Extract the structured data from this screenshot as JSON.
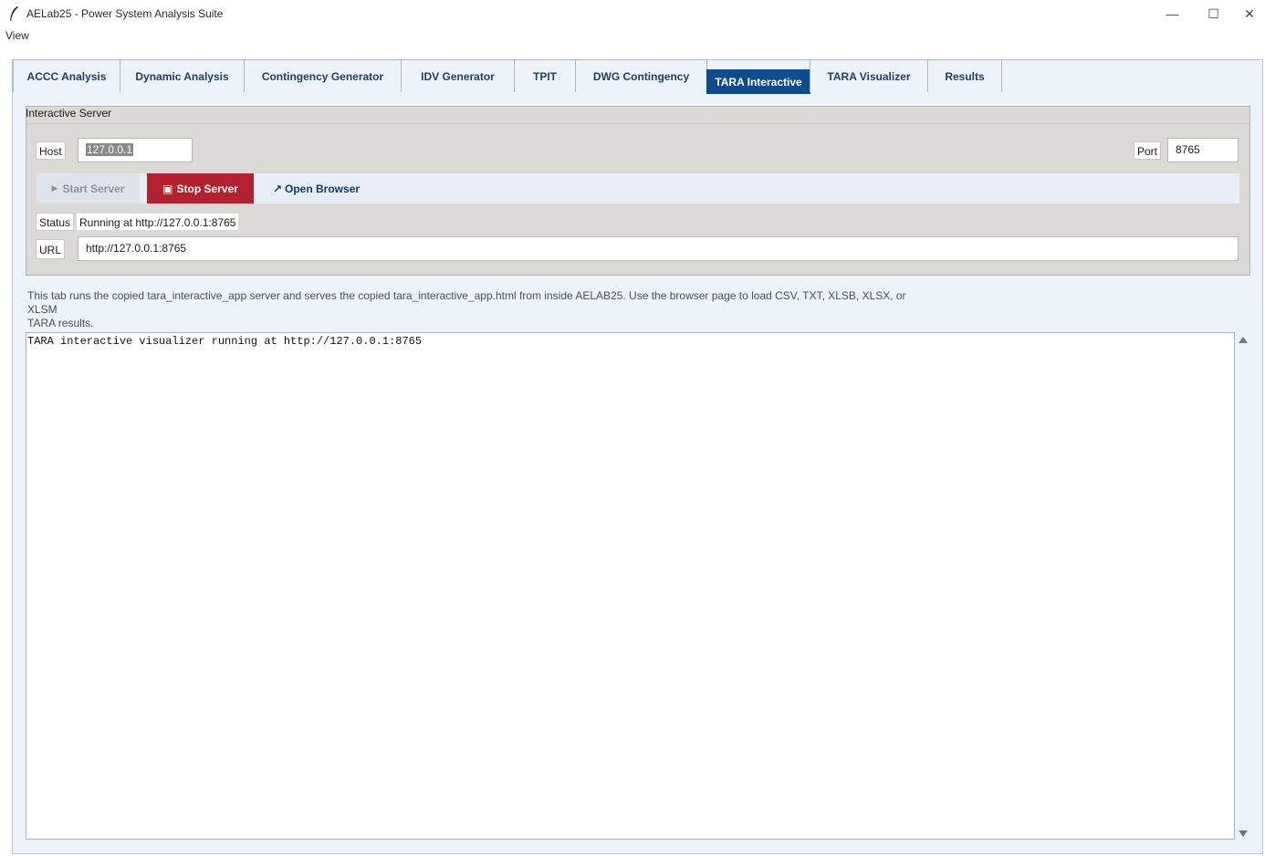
{
  "window": {
    "title": "AELab25 - Power System Analysis Suite",
    "minimize_glyph": "—",
    "maximize_glyph": "☐",
    "close_glyph": "✕"
  },
  "menu": {
    "view": "View"
  },
  "tabs": [
    {
      "label": "ACCC Analysis"
    },
    {
      "label": "Dynamic Analysis"
    },
    {
      "label": "Contingency Generator"
    },
    {
      "label": "IDV Generator"
    },
    {
      "label": "TPIT"
    },
    {
      "label": "DWG Contingency"
    },
    {
      "label": "TARA Interactive",
      "active": true
    },
    {
      "label": "TARA Visualizer"
    },
    {
      "label": "Results"
    }
  ],
  "server": {
    "group_title": "Interactive Server",
    "host_label": "Host",
    "host_value": "127.0.0.1",
    "port_label": "Port",
    "port_value": "8765",
    "start_glyph": "▶",
    "start_label": "Start Server",
    "stop_glyph": "▣",
    "stop_label": "Stop Server",
    "open_glyph": "↗",
    "open_label": "Open Browser",
    "status_label": "Status",
    "status_value": "Running at http://127.0.0.1:8765",
    "url_label": "URL",
    "url_value": "http://127.0.0.1:8765"
  },
  "description_line1": "This tab runs the copied tara_interactive_app server and serves the copied tara_interactive_app.html from inside AELAB25. Use the browser page to load CSV, TXT, XLSB, XLSX, or XLSM",
  "description_line2": "TARA results.",
  "log": {
    "text": "TARA interactive visualizer running at http://127.0.0.1:8765"
  },
  "colors": {
    "accent": "#0f4c8f",
    "stop_button": "#b5202e",
    "panel_bg": "#edf3fb",
    "group_bg": "#dcdad6"
  },
  "icons": {
    "app": "feather-icon",
    "start": "play-icon",
    "stop": "stop-icon",
    "open": "external-link-icon"
  }
}
